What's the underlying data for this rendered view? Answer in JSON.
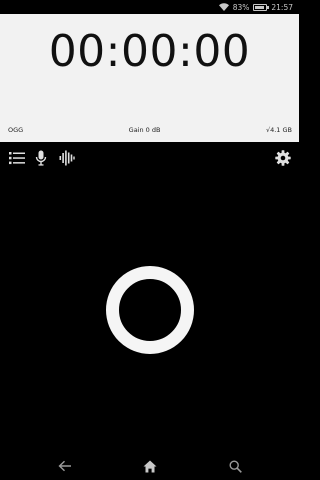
{
  "status_bar": {
    "battery_percent": "83%",
    "battery_level": 0.83,
    "time": "21:57",
    "icons": [
      "wifi-icon",
      "battery-icon"
    ]
  },
  "recorder": {
    "timer": "00:00:00",
    "format": "OGG",
    "gain": "Gain 0 dB",
    "storage": "√4.1 GB"
  },
  "toolbar": {
    "icons": [
      "list-icon",
      "microphone-icon",
      "waveform-icon",
      "gear-icon"
    ]
  },
  "record_button": {
    "icon": "record-ring-icon"
  },
  "navbar": {
    "icons": [
      "back-arrow-icon",
      "home-icon",
      "search-icon"
    ]
  },
  "colors": {
    "background": "#000000",
    "panel": "#f2f2f2",
    "text_dark": "#111111",
    "icon_light": "#e0e0e0"
  }
}
